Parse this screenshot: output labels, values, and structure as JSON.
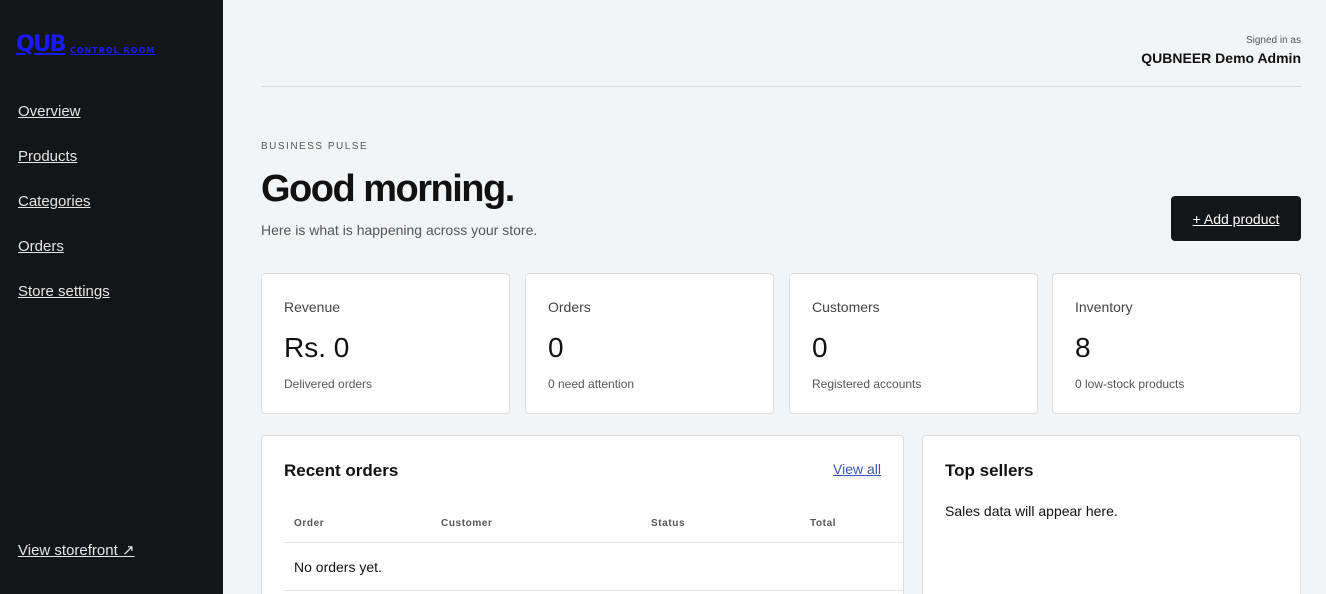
{
  "brand": {
    "mark": "QUB",
    "sub": "CONTROL ROOM"
  },
  "nav": [
    {
      "label": "Overview"
    },
    {
      "label": "Products"
    },
    {
      "label": "Categories"
    },
    {
      "label": "Orders"
    },
    {
      "label": "Store settings"
    }
  ],
  "storefront_link": "View storefront ↗",
  "user": {
    "signed_label": "Signed in as",
    "name": "QUBNEER Demo Admin"
  },
  "header": {
    "eyebrow": "BUSINESS PULSE",
    "greeting": "Good morning.",
    "subtitle": "Here is what is happening across your store.",
    "add_button": "+ Add product"
  },
  "stats": [
    {
      "label": "Revenue",
      "value": "Rs. 0",
      "note": "Delivered orders"
    },
    {
      "label": "Orders",
      "value": "0",
      "note": "0 need attention"
    },
    {
      "label": "Customers",
      "value": "0",
      "note": "Registered accounts"
    },
    {
      "label": "Inventory",
      "value": "8",
      "note": "0 low-stock products"
    }
  ],
  "recent_orders": {
    "title": "Recent orders",
    "view_all": "View all",
    "columns": [
      "Order",
      "Customer",
      "Status",
      "Total"
    ],
    "empty": "No orders yet."
  },
  "top_sellers": {
    "title": "Top sellers",
    "empty": "Sales data will appear here."
  },
  "colors": {
    "sidebar": "#141517",
    "background": "#f3f4f6",
    "logo": "#1a1aff",
    "link": "#3a56b5"
  }
}
